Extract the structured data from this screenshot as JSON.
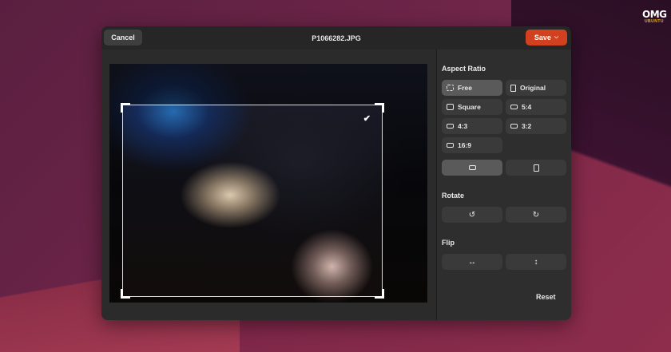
{
  "window": {
    "title": "P1066282.JPG",
    "cancel_label": "Cancel",
    "save_label": "Save",
    "save_chevron": "⌵"
  },
  "logo": {
    "big": "OMG",
    "small": "UBUNTU"
  },
  "colors": {
    "accent": "#d1401f",
    "panel": "#2e2e2e",
    "button": "#3a3a3a",
    "active_button": "#5a5a5a"
  },
  "sidebar": {
    "aspect_ratio_title": "Aspect Ratio",
    "aspect_options": [
      {
        "label": "Free",
        "icon": "free-crop-icon",
        "active": true
      },
      {
        "label": "Original",
        "icon": "original-image-icon",
        "active": false
      },
      {
        "label": "Square",
        "icon": "square-icon",
        "active": false
      },
      {
        "label": "5:4",
        "icon": "ratio-icon",
        "active": false
      },
      {
        "label": "4:3",
        "icon": "ratio-icon",
        "active": false
      },
      {
        "label": "3:2",
        "icon": "ratio-icon",
        "active": false
      },
      {
        "label": "16:9",
        "icon": "ratio-icon",
        "active": false
      }
    ],
    "orientation": [
      {
        "icon": "landscape-icon",
        "active": true
      },
      {
        "icon": "portrait-icon",
        "active": false
      }
    ],
    "rotate_title": "Rotate",
    "rotate": [
      {
        "icon": "rotate-left-icon",
        "glyph": "↺"
      },
      {
        "icon": "rotate-right-icon",
        "glyph": "↻"
      }
    ],
    "flip_title": "Flip",
    "flip": [
      {
        "icon": "flip-horizontal-icon",
        "glyph": "↔"
      },
      {
        "icon": "flip-vertical-icon",
        "glyph": "↕"
      }
    ],
    "reset_label": "Reset"
  },
  "crop": {
    "confirm_glyph": "✔"
  }
}
